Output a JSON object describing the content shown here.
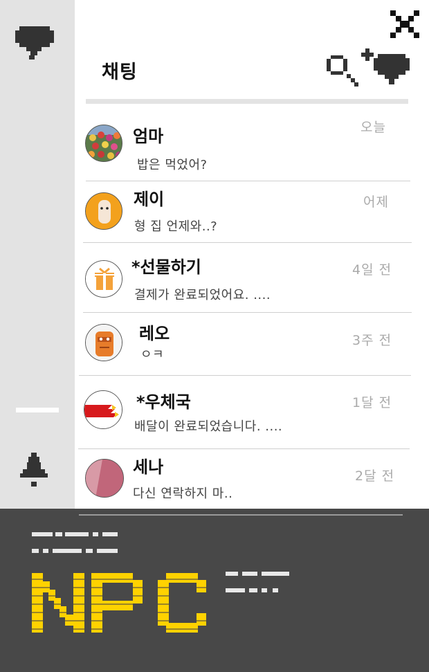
{
  "header": {
    "title": "채팅",
    "close_icon": "close-icon",
    "add_chat_icon": "add-chat-icon"
  },
  "sidebar": {
    "chat_icon": "chat-bubble-icon",
    "bell_icon": "bell-icon"
  },
  "chats": [
    {
      "name": "엄마",
      "preview": "밥은 먹었어?",
      "time": "오늘",
      "avatar": "tulips"
    },
    {
      "name": "제이",
      "preview": "형 집 언제와..?",
      "time": "어제",
      "avatar": "orange-character"
    },
    {
      "name": "*선물하기",
      "preview": "결제가 완료되었어요. ....",
      "time": "4일 전",
      "avatar": "gift-box"
    },
    {
      "name": "레오",
      "preview": "ㅇㅋ",
      "time": "3주 전",
      "avatar": "orange-robot"
    },
    {
      "name": "*우체국",
      "preview": "배달이 완료되었습니다. ....",
      "time": "1달 전",
      "avatar": "post-office"
    },
    {
      "name": "세나",
      "preview": "다신 연락하지 마..",
      "time": "2달 전",
      "avatar": "pink-circle"
    }
  ],
  "footer": {
    "logo": "NPC",
    "logo_color": "#ffd200",
    "background": "#484848"
  }
}
